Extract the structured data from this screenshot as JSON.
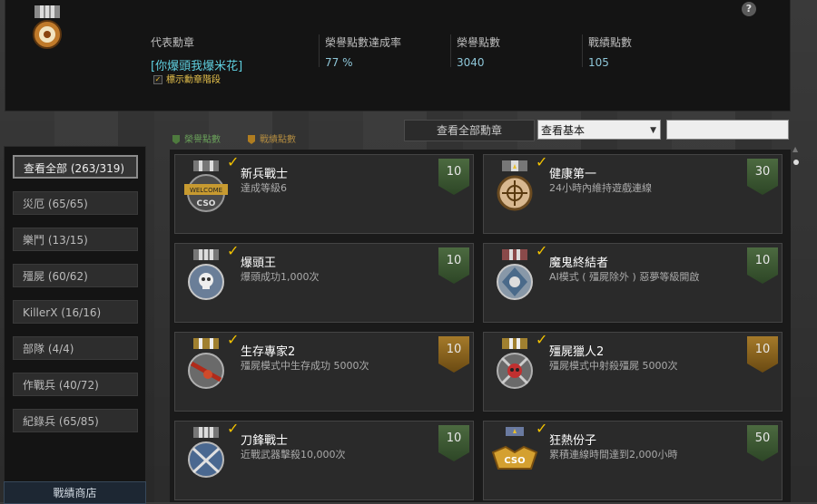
{
  "help": {
    "label": "?"
  },
  "representative": {
    "label": "代表勳章",
    "value": "[你爆頭我爆米花]",
    "show_grade_label": "標示勳章階段"
  },
  "stats": [
    {
      "label": "榮譽點數達成率",
      "value": "77 %"
    },
    {
      "label": "榮譽點數",
      "value": "3040"
    },
    {
      "label": "戰績點數",
      "value": "105"
    }
  ],
  "toolbar": {
    "view_all_label": "查看全部勳章",
    "filter_selected": "查看基本",
    "legend_honor": "榮譽點數",
    "legend_record": "戰績點數",
    "legend_honor_color": "#4e7a3e",
    "legend_record_color": "#b07d20"
  },
  "sidebar": {
    "items": [
      {
        "label": "查看全部 (263/319)",
        "selected": true
      },
      {
        "label": "災厄 (65/65)"
      },
      {
        "label": "樂鬥 (13/15)"
      },
      {
        "label": "殭屍 (60/62)"
      },
      {
        "label": "KillerX (16/16)"
      },
      {
        "label": "部隊 (4/4)"
      },
      {
        "label": "作戰兵 (40/72)"
      },
      {
        "label": "紀錄兵 (65/85)"
      }
    ],
    "shop_label": "戰績商店"
  },
  "medals": [
    {
      "name": "新兵戰士",
      "desc": "達成等級6",
      "points": "10",
      "type": "green",
      "icon": "welcome-cso-medal-icon"
    },
    {
      "name": "健康第一",
      "desc": "24小時內維持遊戲連線",
      "points": "30",
      "type": "green",
      "icon": "crosshair-medal-icon"
    },
    {
      "name": "爆頭王",
      "desc": "爆頭成功1,000次",
      "points": "10",
      "type": "green",
      "icon": "skull-medal-icon"
    },
    {
      "name": "魔鬼終結者",
      "desc": "AI模式 ( 殭屍除外 ) 惡夢等級開啟",
      "points": "10",
      "type": "green",
      "icon": "demon-medal-icon"
    },
    {
      "name": "生存專家2",
      "desc": "殭屍模式中生存成功 5000次",
      "points": "10",
      "type": "gold",
      "icon": "survivor-medal-icon"
    },
    {
      "name": "殭屍獵人2",
      "desc": "殭屍模式中射殺殭屍 5000次",
      "points": "10",
      "type": "gold",
      "icon": "zombie-skull-medal-icon"
    },
    {
      "name": "刀鋒戰士",
      "desc": "近戰武器擊殺10,000次",
      "points": "10",
      "type": "green",
      "icon": "crossed-blades-medal-icon"
    },
    {
      "name": "狂熱份子",
      "desc": "累積連線時間達到2,000小時",
      "points": "50",
      "type": "green",
      "icon": "cso-wings-medal-icon"
    }
  ],
  "colors": {
    "badge_green": "#3d5a33",
    "badge_gold": "#8a6420",
    "accent_blue": "#8ec6d8",
    "check_yellow": "#f2c200"
  }
}
